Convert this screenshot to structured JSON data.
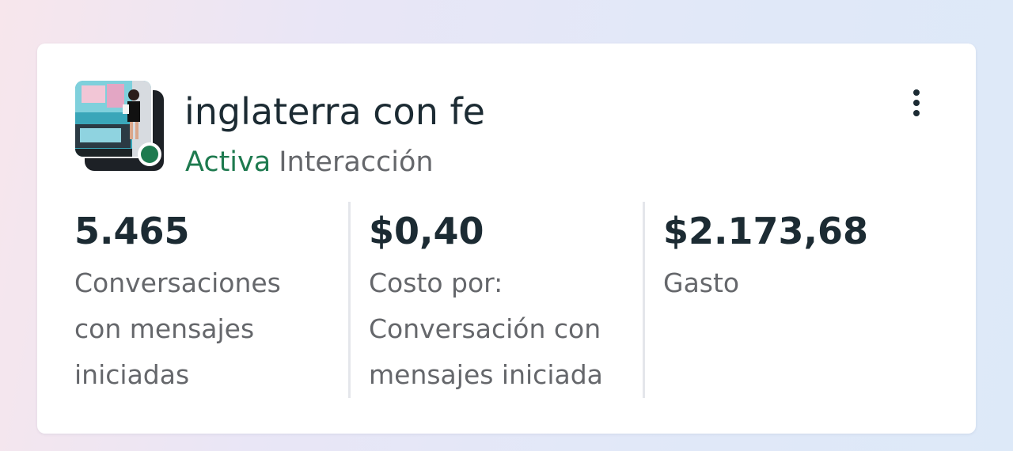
{
  "campaign": {
    "name": "inglaterra con fe",
    "status": "Activa",
    "objective": "Interacción"
  },
  "metrics": [
    {
      "value": "5.465",
      "label": "Conversaciones con mensajes iniciadas"
    },
    {
      "value": "$0,40",
      "label": "Costo por: Conversación con mensajes iniciada"
    },
    {
      "value": "$2.173,68",
      "label": "Gasto"
    }
  ],
  "icons": {
    "menu": "more-vertical-icon",
    "status": "active-status-dot-icon",
    "thumbnail": "campaign-thumbnail"
  },
  "colors": {
    "active_green": "#1e7a4f",
    "text_primary": "#1c2b33",
    "text_secondary": "#65676b",
    "divider": "#e4e6eb"
  }
}
